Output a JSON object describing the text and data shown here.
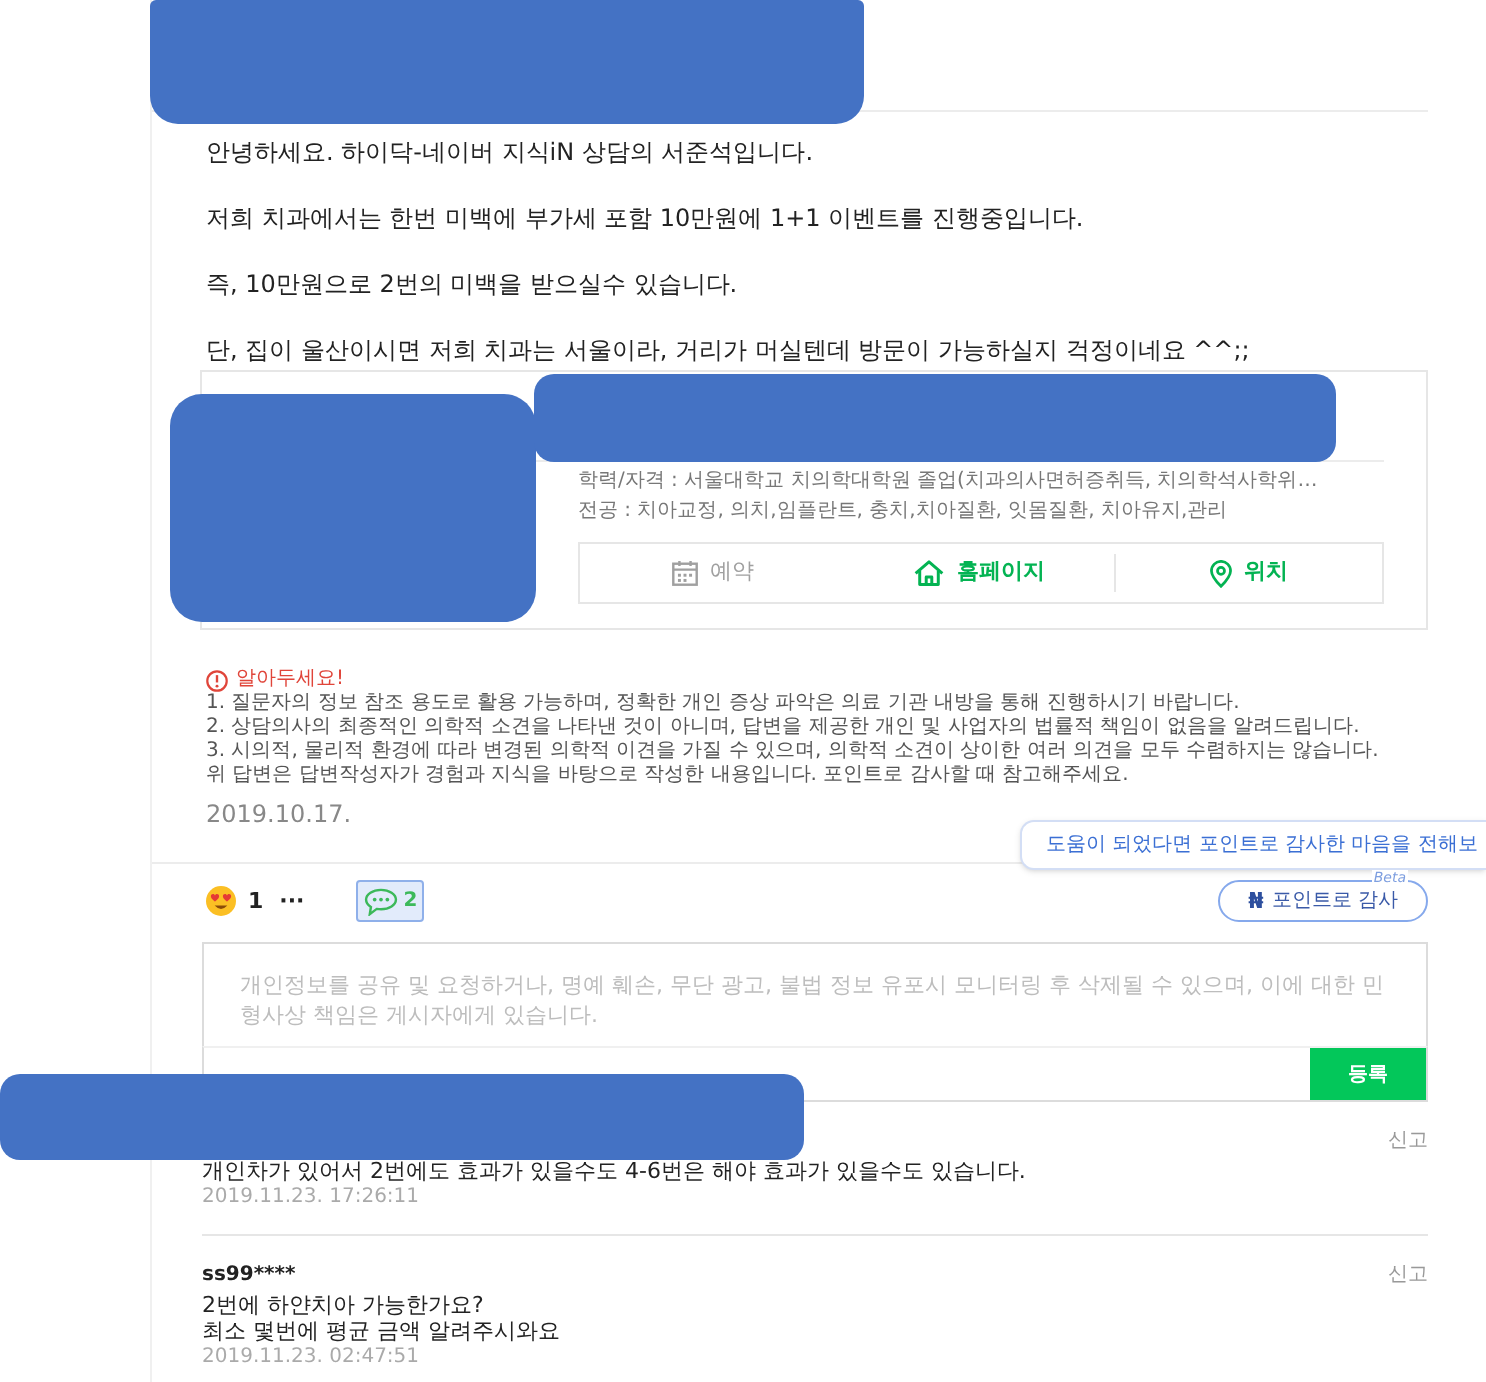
{
  "answer": {
    "paragraphs": [
      "안녕하세요. 하이닥-네이버 지식iN 상담의 서준석입니다.",
      "저희 치과에서는 한번 미백에 부가세 포함 10만원에 1+1 이벤트를 진행중입니다.",
      "즉, 10만원으로 2번의 미백을 받으실수 있습니다.",
      "단, 집이 울산이시면 저희 치과는 서울이라, 거리가 머실텐데 방문이 가능하실지 걱정이네요 ^^;;"
    ]
  },
  "expert_card": {
    "credentials": "학력/자격 : 서울대학교 치의학대학원 졸업(치과의사면허증취득, 치의학석사학위…",
    "specialty": "전공 : 치아교정, 의치,임플란트, 충치,치아질환, 잇몸질환, 치아유지,관리",
    "actions": [
      {
        "kind": "reservation",
        "label": "예약",
        "disabled": true
      },
      {
        "kind": "homepage",
        "label": "홈페이지",
        "disabled": false
      },
      {
        "kind": "location",
        "label": "위치",
        "disabled": false
      }
    ]
  },
  "notice": {
    "title": "알아두세요!",
    "lines": [
      "1. 질문자의 정보 참조 용도로 활용 가능하며, 정확한 개인 증상 파악은 의료 기관 내방을 통해 진행하시기 바랍니다.",
      "2. 상담의사의 최종적인 의학적 소견을 나타낸 것이 아니며, 답변을 제공한 개인 및 사업자의 법률적 책임이 없음을 알려드립니다.",
      "3. 시의적, 물리적 환경에 따라 변경된 의학적 이견을 가질 수 있으며, 의학적 소견이 상이한 여러 의견을 모두 수렴하지는 않습니다.",
      "위 답변은 답변작성자가 경험과 지식을 바탕으로 작성한 내용입니다. 포인트로 감사할 때 참고해주세요."
    ]
  },
  "answer_date": "2019.10.17.",
  "tooltip": "도움이 되었다면 포인트로 감사한 마음을 전해보",
  "reactions": {
    "like_count": "1",
    "more": "···",
    "comment_button": {
      "count": "2",
      "selected": true
    }
  },
  "thanks_button": {
    "icon": "₦",
    "label": "포인트로 감사",
    "badge": "Beta"
  },
  "comment_form": {
    "placeholder": "개인정보를 공유 및 요청하거나, 명예 훼손, 무단 광고, 불법 정보 유포시 모니터링 후 삭제될 수 있으며, 이에 대한 민형사상 책임은 게시자에게 있습니다.",
    "submit": "등록"
  },
  "comments": [
    {
      "report": "신고",
      "text": "개인차가 있어서 2번에도 효과가 있을수도 4-6번은 해야 효과가 있을수도 있습니다.",
      "time": "2019.11.23. 17:26:11"
    },
    {
      "author": "ss99****",
      "report": "신고",
      "text": "2번에 하얀치아 가능한가요?\n최소 몇번에 평균 금액 알려주시와요",
      "time": "2019.11.23. 02:47:51"
    }
  ]
}
